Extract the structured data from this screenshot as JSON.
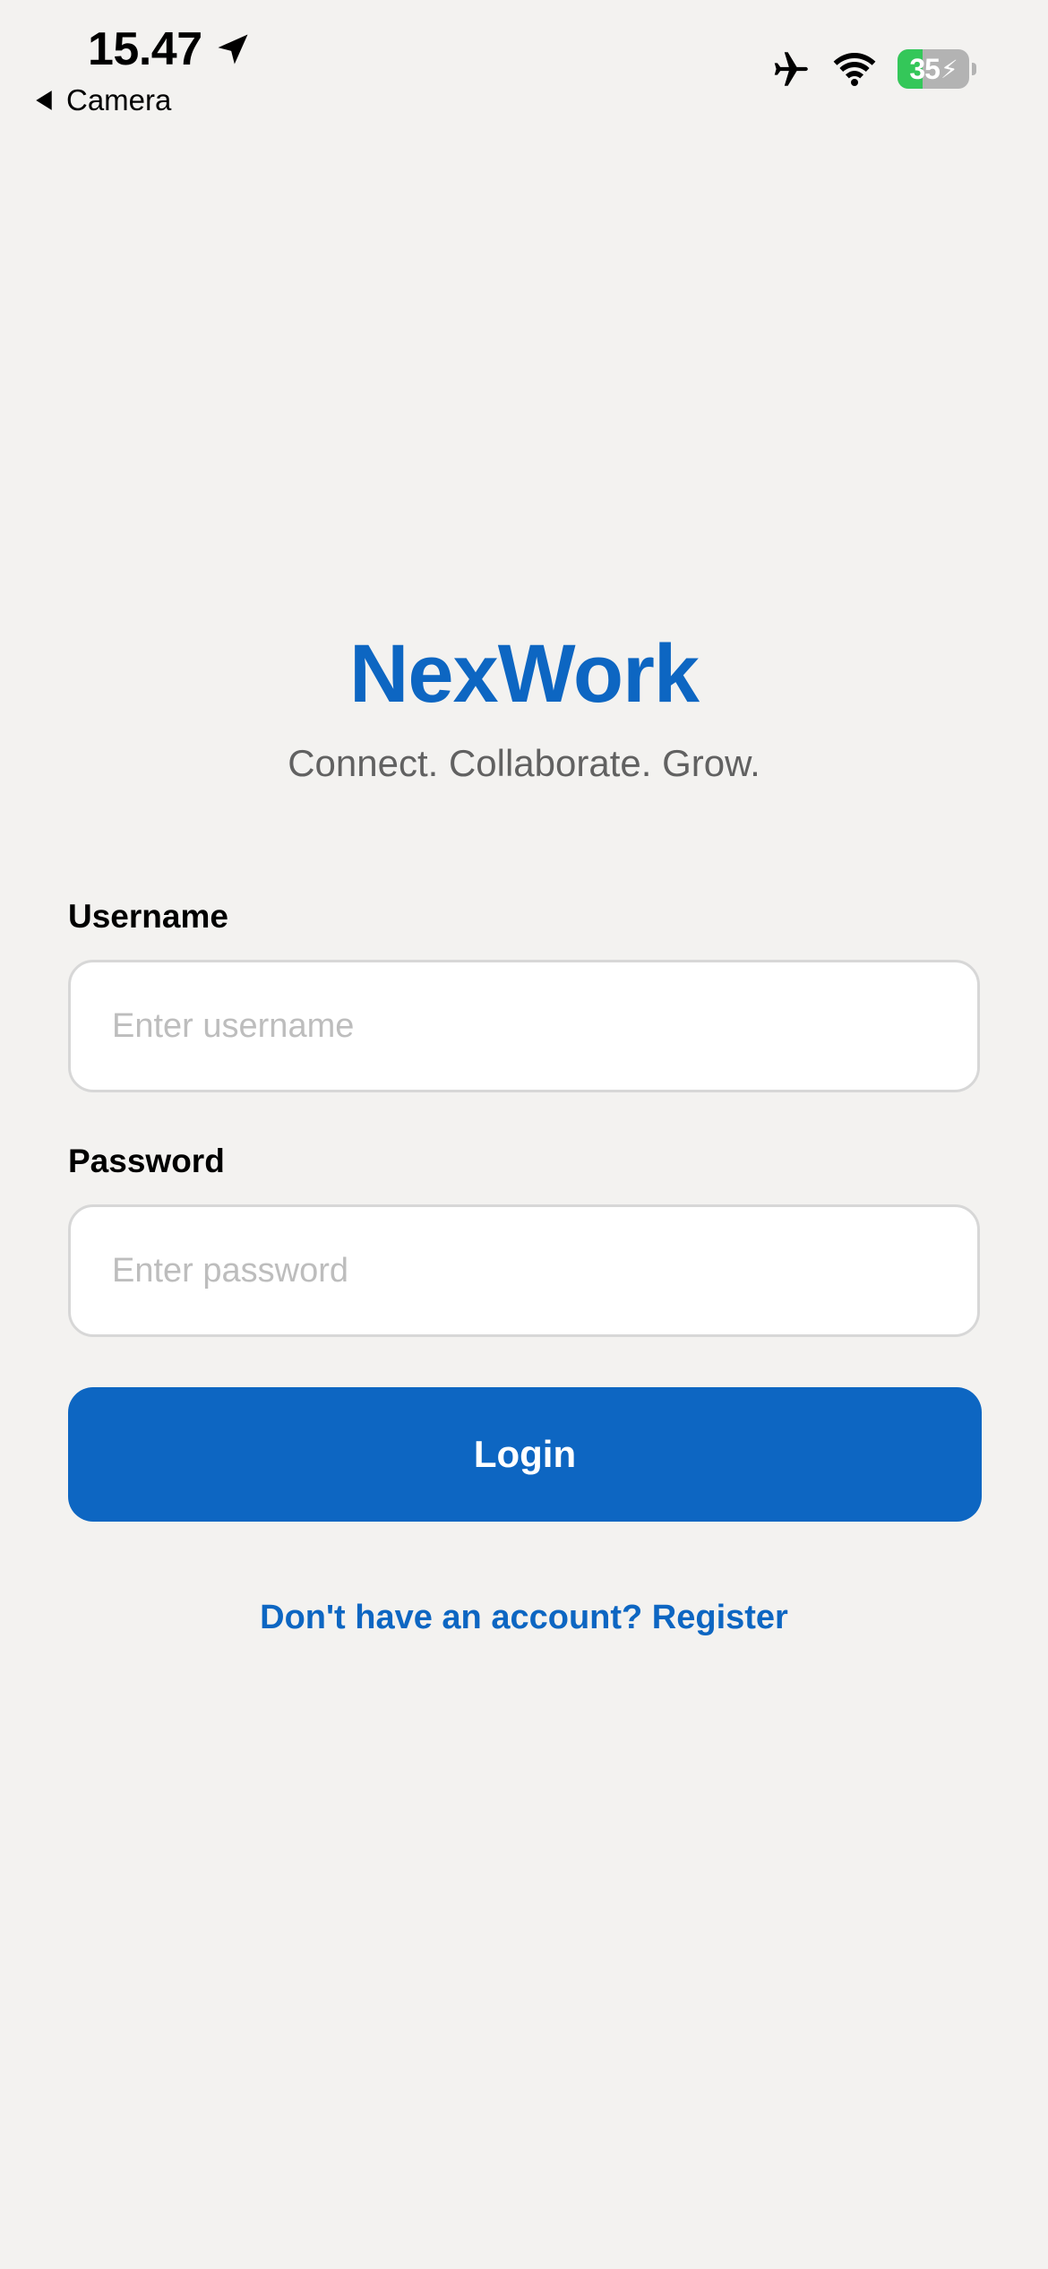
{
  "status_bar": {
    "time": "15.47",
    "back_label": "Camera",
    "battery_percent": "35",
    "battery_level": 0.35,
    "icons": [
      "location-arrow-icon",
      "airplane-mode-icon",
      "wifi-icon",
      "battery-charging-icon"
    ]
  },
  "brand": {
    "title": "NexWork",
    "tagline": "Connect. Collaborate. Grow."
  },
  "form": {
    "username_label": "Username",
    "username_placeholder": "Enter username",
    "username_value": "",
    "password_label": "Password",
    "password_placeholder": "Enter password",
    "password_value": "",
    "login_label": "Login",
    "register_text": "Don't have an account? Register"
  },
  "colors": {
    "accent": "#0d66c2",
    "background": "#f3f2f0",
    "battery_green": "#34c759"
  }
}
